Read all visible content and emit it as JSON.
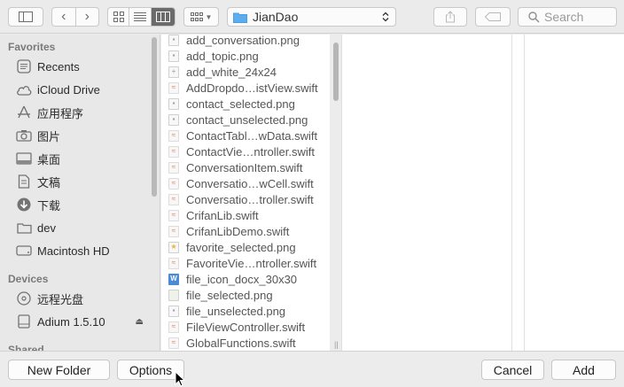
{
  "toolbar": {
    "path_label": "JianDao",
    "search_placeholder": "Search"
  },
  "sidebar": {
    "favorites_header": "Favorites",
    "favorites": [
      {
        "label": "Recents",
        "icon": "clock-icon"
      },
      {
        "label": "iCloud Drive",
        "icon": "cloud-icon"
      },
      {
        "label": "应用程序",
        "icon": "applications-icon"
      },
      {
        "label": "图片",
        "icon": "camera-icon"
      },
      {
        "label": "桌面",
        "icon": "desktop-icon"
      },
      {
        "label": "文稿",
        "icon": "document-icon"
      },
      {
        "label": "下载",
        "icon": "download-icon"
      },
      {
        "label": "dev",
        "icon": "folder-icon"
      },
      {
        "label": "Macintosh HD",
        "icon": "hard-drive-icon"
      }
    ],
    "devices_header": "Devices",
    "devices": [
      {
        "label": "远程光盘",
        "icon": "disc-icon"
      },
      {
        "label": "Adium 1.5.10",
        "icon": "drive-icon"
      }
    ],
    "shared_header": "Shared"
  },
  "files": [
    {
      "name": "add_conversation.png",
      "type": "png"
    },
    {
      "name": "add_topic.png",
      "type": "png"
    },
    {
      "name": "add_white_24x24",
      "type": "plus"
    },
    {
      "name": "AddDropdo…istView.swift",
      "type": "swift"
    },
    {
      "name": "contact_selected.png",
      "type": "png"
    },
    {
      "name": "contact_unselected.png",
      "type": "png"
    },
    {
      "name": "ContactTabl…wData.swift",
      "type": "swift"
    },
    {
      "name": "ContactVie…ntroller.swift",
      "type": "swift"
    },
    {
      "name": "ConversationItem.swift",
      "type": "swift"
    },
    {
      "name": "Conversatio…wCell.swift",
      "type": "swift"
    },
    {
      "name": "Conversatio…troller.swift",
      "type": "swift"
    },
    {
      "name": "CrifanLib.swift",
      "type": "swift"
    },
    {
      "name": "CrifanLibDemo.swift",
      "type": "swift"
    },
    {
      "name": "favorite_selected.png",
      "type": "star"
    },
    {
      "name": "FavoriteVie…ntroller.swift",
      "type": "swift"
    },
    {
      "name": "file_icon_docx_30x30",
      "type": "word"
    },
    {
      "name": "file_selected.png",
      "type": "img"
    },
    {
      "name": "file_unselected.png",
      "type": "png"
    },
    {
      "name": "FileViewController.swift",
      "type": "swift"
    },
    {
      "name": "GlobalFunctions.swift",
      "type": "swift"
    }
  ],
  "bottom": {
    "new_folder": "New Folder",
    "options": "Options",
    "cancel": "Cancel",
    "add": "Add"
  },
  "colors": {
    "folder_blue": "#5aaef0",
    "swift_orange": "#e8704a",
    "active_segment": "#6b6b6b"
  }
}
